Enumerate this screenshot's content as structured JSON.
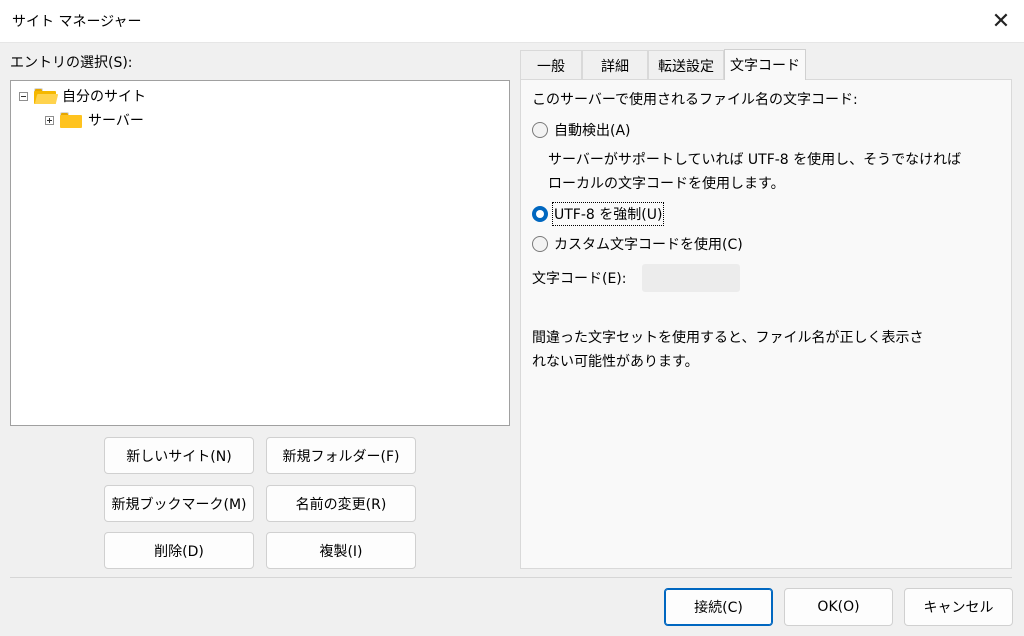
{
  "window": {
    "title": "サイト マネージャー",
    "close_glyph": "✕"
  },
  "left": {
    "entry_label": "エントリの選択(S):",
    "tree": [
      {
        "label": "自分のサイト",
        "expanded": true
      },
      {
        "label": "サーバー",
        "expanded": false
      }
    ],
    "buttons": {
      "new_site": "新しいサイト(N)",
      "new_folder": "新規フォルダー(F)",
      "new_bookmark": "新規ブックマーク(M)",
      "rename": "名前の変更(R)",
      "delete": "削除(D)",
      "duplicate": "複製(I)"
    }
  },
  "tabs": [
    {
      "label": "一般",
      "active": false
    },
    {
      "label": "詳細",
      "active": false
    },
    {
      "label": "転送設定",
      "active": false
    },
    {
      "label": "文字コード",
      "active": true
    }
  ],
  "charset_panel": {
    "heading": "このサーバーで使用されるファイル名の文字コード:",
    "auto_detect": "自動検出(A)",
    "auto_desc_line1": "サーバーがサポートしていれば UTF-8 を使用し、そうでなければ",
    "auto_desc_line2": "ローカルの文字コードを使用します。",
    "force_utf8": "UTF-8 を強制(U)",
    "custom": "カスタム文字コードを使用(C)",
    "encoding_label": "文字コード(E):",
    "encoding_value": "",
    "selected": "force_utf8",
    "warning_line1": "間違った文字セットを使用すると、ファイル名が正しく表示さ",
    "warning_line2": "れない可能性があります。"
  },
  "footer": {
    "connect": "接続(C)",
    "ok": "OK(O)",
    "cancel": "キャンセル"
  },
  "colors": {
    "accent": "#0067c0",
    "folder": "#ffc31f"
  }
}
